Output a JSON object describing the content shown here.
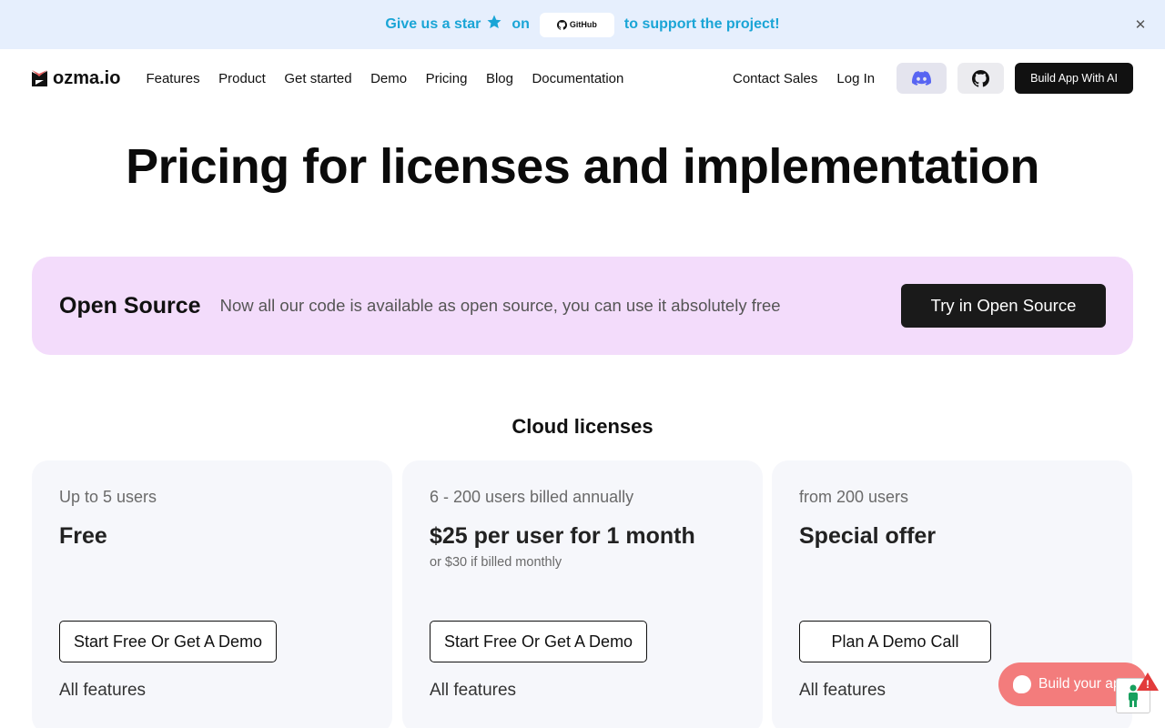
{
  "banner": {
    "text_before": "Give us a star",
    "text_on": "on",
    "github_label": "GitHub",
    "text_after": "to support the project!",
    "close_icon": "close-icon"
  },
  "nav": {
    "logo_text": "ozma.io",
    "links": [
      "Features",
      "Product",
      "Get started",
      "Demo",
      "Pricing",
      "Blog",
      "Documentation"
    ],
    "contact": "Contact Sales",
    "login": "Log In",
    "discord_icon": "discord-icon",
    "github_icon": "github-icon",
    "build_button": "Build App With AI"
  },
  "hero": {
    "title": "Pricing for licenses and implementation"
  },
  "open_source": {
    "title": "Open Source",
    "description": "Now all our code is available as open source, you can use it absolutely free",
    "button": "Try in Open Source"
  },
  "cloud": {
    "title": "Cloud licenses",
    "cards": [
      {
        "users": "Up to 5 users",
        "price": "Free",
        "note": "",
        "button": "Start Free Or Get A Demo",
        "features": "All features"
      },
      {
        "users": "6 - 200 users billed annually",
        "price": "$25 per user for 1 month",
        "note": "or $30 if billed monthly",
        "button": "Start Free Or Get A Demo",
        "features": "All features"
      },
      {
        "users": "from 200 users",
        "price": "Special offer",
        "note": "",
        "button": "Plan A Demo Call",
        "features": "All features"
      }
    ]
  },
  "widget": {
    "label": "Build your app",
    "alert_mark": "!"
  },
  "colors": {
    "banner_bg": "#e6effd",
    "banner_text": "#1aa5d6",
    "open_source_bg": "#f3dcfb",
    "card_bg": "#f6f7fb",
    "widget_bg": "#f37c7c",
    "discord": "#5865f2"
  }
}
